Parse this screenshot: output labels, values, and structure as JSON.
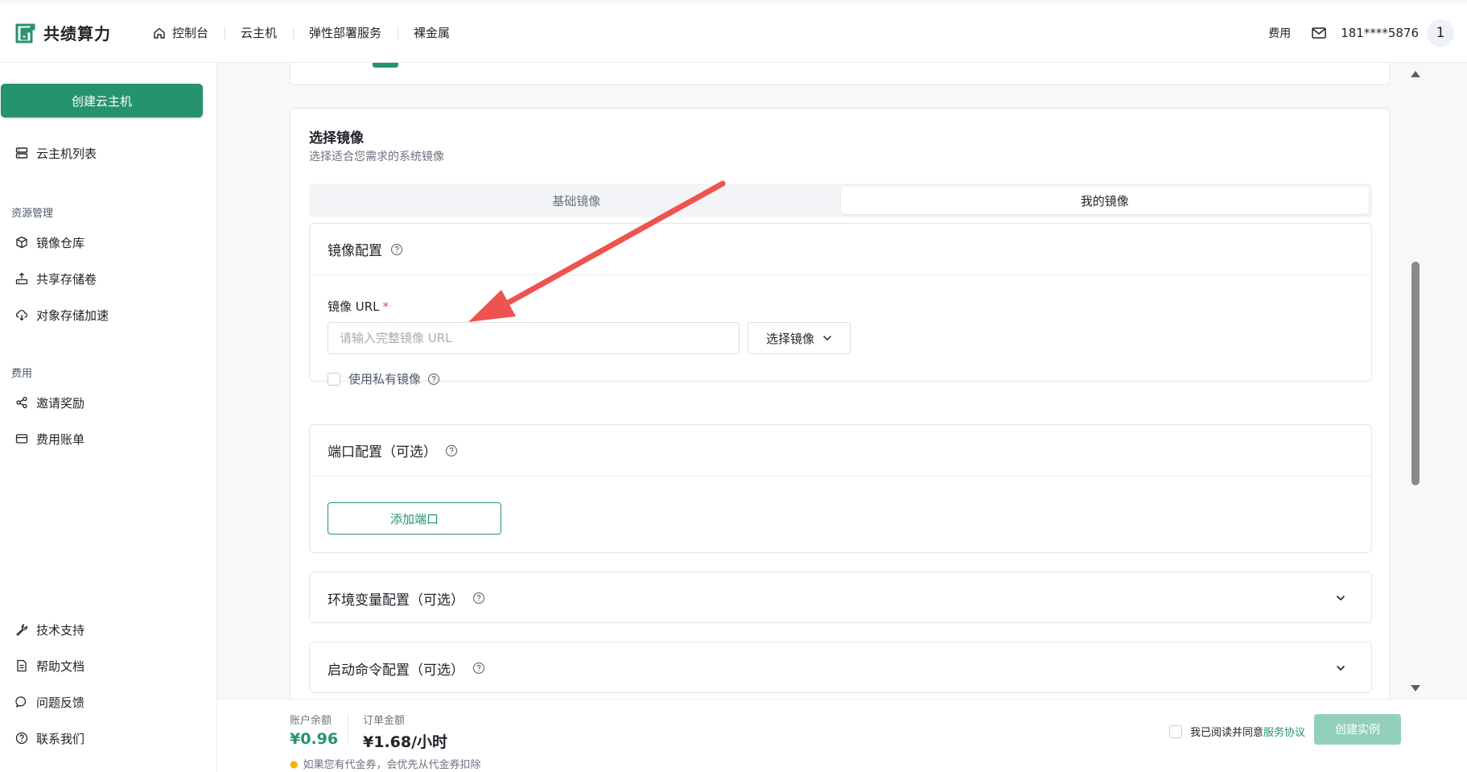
{
  "brand": {
    "name": "共绩算力",
    "color": "#26936f"
  },
  "nav": {
    "items": [
      {
        "label": "控制台",
        "icon": "home-icon"
      },
      {
        "label": "云主机"
      },
      {
        "label": "弹性部署服务"
      },
      {
        "label": "裸金属"
      }
    ]
  },
  "header_right": {
    "fee": "费用",
    "phone": "181****5876",
    "avatar": "1"
  },
  "sidebar": {
    "create_button": "创建云主机",
    "vm_list": "云主机列表",
    "section_resources": "资源管理",
    "image_repo": "镜像仓库",
    "shared_storage": "共享存储卷",
    "object_storage": "对象存储加速",
    "section_fees": "费用",
    "invite": "邀请奖励",
    "bills": "费用账单",
    "support": "技术支持",
    "docs": "帮助文档",
    "feedback": "问题反馈",
    "contact": "联系我们"
  },
  "image_section": {
    "title": "选择镜像",
    "subtitle": "选择适合您需求的系统镜像",
    "tabs": [
      {
        "label": "基础镜像",
        "active": false
      },
      {
        "label": "我的镜像",
        "active": true
      }
    ],
    "config": {
      "title": "镜像配置",
      "url_label": "镜像 URL",
      "required_mark": "*",
      "url_placeholder": "请输入完整镜像 URL",
      "url_value": "",
      "select_button": "选择镜像",
      "private_label": "使用私有镜像",
      "private_checked": false
    },
    "port": {
      "title": "端口配置（可选）",
      "add_button": "添加端口"
    },
    "env": {
      "title": "环境变量配置（可选）"
    },
    "startup": {
      "title": "启动命令配置（可选）"
    }
  },
  "footer": {
    "balance_label": "账户余额",
    "balance_value": "¥0.96",
    "order_label": "订单金额",
    "order_value": "¥1.68/小时",
    "tip": "如果您有代金券，会优先从代金券扣除",
    "agree_text": "我已阅读并同意",
    "agree_link": "服务协议",
    "create_instance": "创建实例"
  },
  "colors": {
    "accent": "#26936f",
    "disabled_accent": "#93cfbd",
    "annotation_arrow": "#ef5350",
    "required": "#e5484d"
  }
}
